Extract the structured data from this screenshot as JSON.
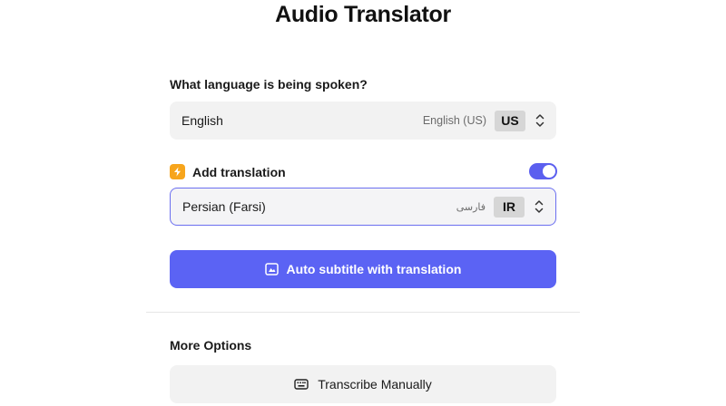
{
  "app": {
    "title": "Audio Translator"
  },
  "source": {
    "question": "What language is being spoken?",
    "language": "English",
    "native": "English (US)",
    "code": "US"
  },
  "translation": {
    "label": "Add translation",
    "enabled": true,
    "language": "Persian (Farsi)",
    "native": "فارسی",
    "code": "IR"
  },
  "actions": {
    "auto_subtitle": "Auto subtitle with translation",
    "more_options": "More Options",
    "transcribe_manually": "Transcribe Manually"
  },
  "colors": {
    "accent": "#5b63f4",
    "toggle": "#5b5fef",
    "bolt": "#f7a51c"
  },
  "icons": {
    "bolt": "bolt-icon",
    "chevron": "chevron-up-down-icon",
    "subtitle": "subtitle-icon",
    "keyboard": "keyboard-icon"
  }
}
